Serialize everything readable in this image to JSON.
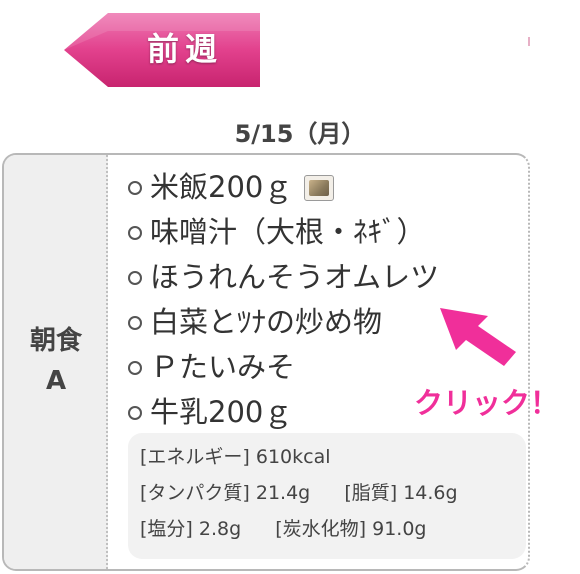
{
  "nav": {
    "prev_week_label": "前週"
  },
  "date_heading": "5/15（月）",
  "meal": {
    "label_line1": "朝食",
    "label_line2": "A",
    "items": [
      "米飯200ｇ",
      "味噌汁（大根・ﾈｷﾞ）",
      "ほうれんそうオムレツ",
      "白菜とﾂﾅの炒め物",
      "Ｐたいみそ",
      "牛乳200ｇ"
    ],
    "item_icons": [
      "photo-icon"
    ]
  },
  "nutrition": {
    "energy_label": "[エネルギー]",
    "energy_value": "610kcal",
    "protein_label": "[タンパク質]",
    "protein_value": "21.4g",
    "fat_label": "[脂質]",
    "fat_value": "14.6g",
    "salt_label": "[塩分]",
    "salt_value": "2.8g",
    "carb_label": "[炭水化物]",
    "carb_value": "91.0g"
  },
  "hint": {
    "text": "クリック！"
  },
  "colors": {
    "accent_pink": "#e2418d",
    "hint_pink": "#f02f9a",
    "border_gray": "#b8b8b8"
  }
}
